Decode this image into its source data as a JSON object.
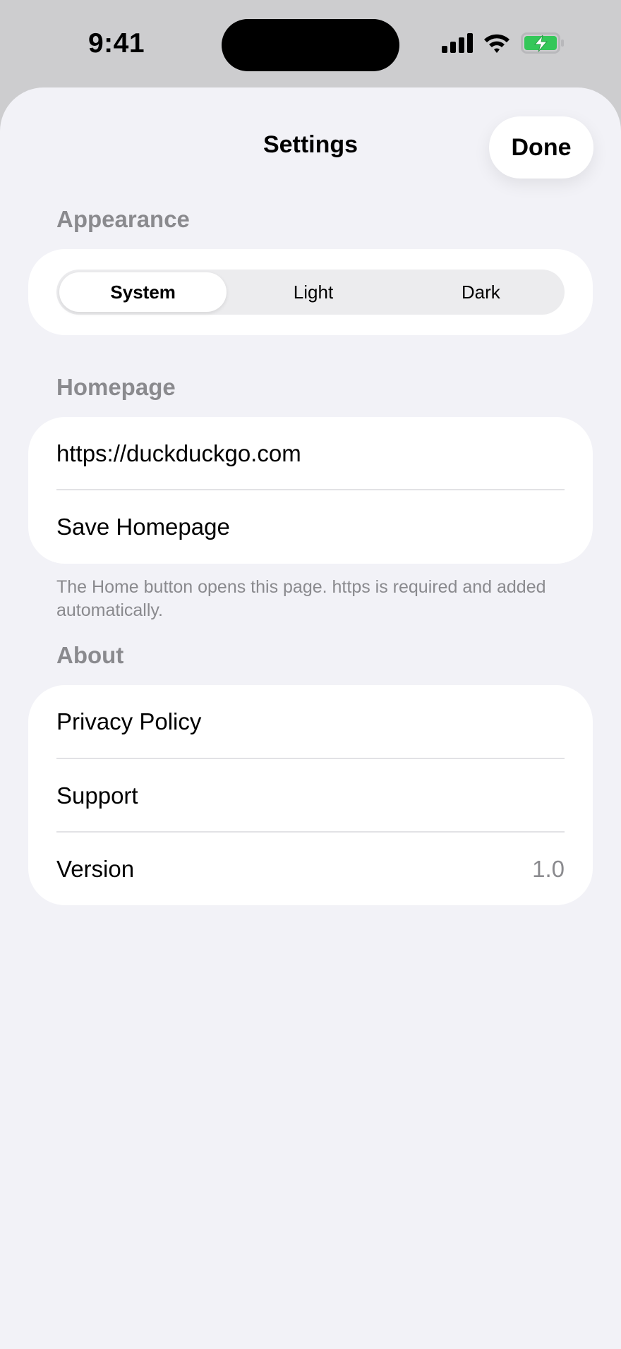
{
  "status_bar": {
    "time": "9:41",
    "icons": [
      "signal-icon",
      "wifi-icon",
      "battery-charging-icon"
    ],
    "battery_color": "#34c759"
  },
  "nav": {
    "title": "Settings",
    "done_label": "Done"
  },
  "appearance": {
    "header": "Appearance",
    "options": [
      "System",
      "Light",
      "Dark"
    ],
    "selected": "System"
  },
  "homepage": {
    "header": "Homepage",
    "url_value": "https://duckduckgo.com",
    "save_label": "Save Homepage",
    "footnote": "The Home button opens this page. https is required and added automatically."
  },
  "about": {
    "header": "About",
    "privacy_label": "Privacy Policy",
    "support_label": "Support",
    "version_label": "Version",
    "version_value": "1.0"
  }
}
